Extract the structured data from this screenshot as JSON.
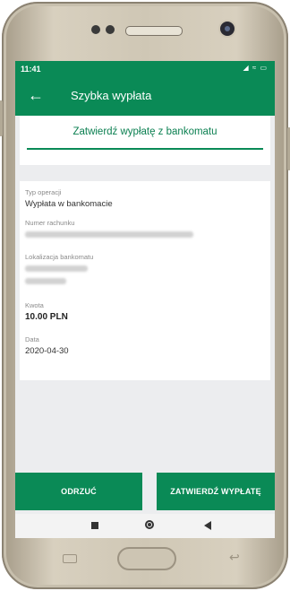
{
  "status_bar": {
    "time": "11:41",
    "icons": "◢ ≈ ▭"
  },
  "app_bar": {
    "back_icon": "←",
    "title": "Szybka wypłata"
  },
  "confirm": {
    "title": "Zatwierdź wypłatę z bankomatu"
  },
  "details": {
    "operation_type_label": "Typ operacji",
    "operation_type_value": "Wypłata w bankomacie",
    "account_number_label": "Numer rachunku",
    "atm_location_label": "Lokalizacja bankomatu",
    "amount_label": "Kwota",
    "amount_value": "10.00 PLN",
    "date_label": "Data",
    "date_value": "2020-04-30"
  },
  "buttons": {
    "reject": "ODRZUĆ",
    "confirm": "ZATWIERDŹ WYPŁATĘ"
  },
  "colors": {
    "brand_green": "#0a8a56",
    "screen_bg": "#ecedef"
  },
  "icons": [
    "back-arrow-icon",
    "nav-recents-icon",
    "nav-home-icon",
    "nav-back-icon"
  ]
}
